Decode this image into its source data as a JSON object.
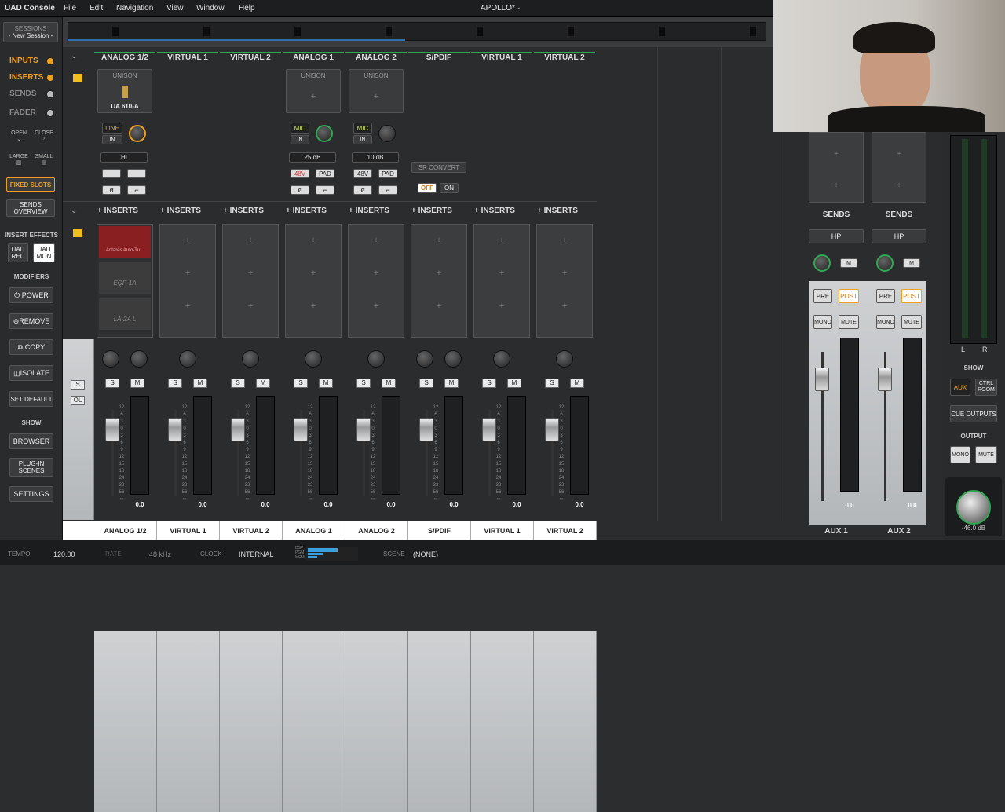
{
  "menubar": {
    "app": "UAD Console",
    "menus": [
      "File",
      "Edit",
      "Navigation",
      "View",
      "Window",
      "Help"
    ],
    "session": "APOLLO*"
  },
  "left": {
    "sessions": "SESSIONS",
    "session_name": "- New Session -",
    "view_buttons": [
      "INPUTS",
      "INSERTS",
      "SENDS",
      "FADER"
    ],
    "open": "OPEN",
    "close": "CLOSE",
    "large": "LARGE",
    "small": "SMALL",
    "fixed_slots": "FIXED SLOTS",
    "sends_overview": "SENDS OVERVIEW",
    "insert_effects": "INSERT EFFECTS",
    "uad_rec": "UAD REC",
    "uad_mon": "UAD MON",
    "modifiers": "MODIFIERS",
    "power": "POWER",
    "remove": "REMOVE",
    "copy": "COPY",
    "isolate": "ISOLATE",
    "set_default": "SET DEFAULT",
    "show": "SHOW",
    "browser": "BROWSER",
    "plugin_scenes": "PLUG-IN SCENES",
    "settings": "SETTINGS"
  },
  "channels": [
    {
      "name": "ANALOG 1/2",
      "unison": "UNISON",
      "plugin": "UA 610-A",
      "type": "LINE",
      "in": "IN",
      "gain": "HI",
      "inserts": [
        "Antares Auto-Tu...",
        "EQP-1A",
        "LA-2A L"
      ],
      "value": "0.0"
    },
    {
      "name": "VIRTUAL 1",
      "value": "0.0"
    },
    {
      "name": "VIRTUAL 2",
      "value": "0.0"
    },
    {
      "name": "ANALOG 1",
      "unison": "UNISON",
      "type": "MIC",
      "in": "IN",
      "gain": "25 dB",
      "v48": "48V",
      "pad": "PAD",
      "value": "0.0"
    },
    {
      "name": "ANALOG 2",
      "unison": "UNISON",
      "type": "MIC",
      "in": "IN",
      "gain": "10 dB",
      "v48": "48V",
      "pad": "PAD",
      "value": "0.0"
    },
    {
      "name": "S/PDIF",
      "sr_convert": "SR CONVERT",
      "off": "OFF",
      "on": "ON",
      "value": "0.0"
    },
    {
      "name": "VIRTUAL 1",
      "value": "0.0"
    },
    {
      "name": "VIRTUAL 2",
      "value": "0.0"
    }
  ],
  "inserts_label": "INSERTS",
  "aux": [
    {
      "name": "AUX 1",
      "sends": "SENDS",
      "hp": "HP",
      "m": "M",
      "pre": "PRE",
      "post": "POST",
      "mono": "MONO",
      "mute": "MUTE",
      "value": "0.0"
    },
    {
      "name": "AUX 2",
      "sends": "SENDS",
      "hp": "HP",
      "m": "M",
      "pre": "PRE",
      "post": "POST",
      "mono": "MONO",
      "mute": "MUTE",
      "value": "0.0"
    }
  ],
  "output": {
    "show": "SHOW",
    "aux": "AUX",
    "ctrl_room": "CTRL ROOM",
    "cue_outputs": "CUE OUTPUTS",
    "output": "OUTPUT",
    "mono": "MONO",
    "mute": "MUTE",
    "level": "-46.0 dB",
    "l": "L",
    "r": "R"
  },
  "bottom": {
    "tempo_label": "TEMPO",
    "tempo": "120.00",
    "rate_label": "RATE",
    "rate": "48 kHz",
    "clock_label": "CLOCK",
    "clock": "INTERNAL",
    "dsp": "DSP",
    "pgm": "PGM",
    "mem": "MEM",
    "scene_label": "SCENE",
    "scene": "(NONE)"
  },
  "scale": [
    "12",
    "6",
    "3",
    "0",
    "3",
    "6",
    "9",
    "12",
    "15",
    "18",
    "24",
    "32",
    "56",
    "∞"
  ],
  "colors": {
    "accent": "#f0a020",
    "green": "#2fa84f",
    "red": "#d23a3a"
  }
}
